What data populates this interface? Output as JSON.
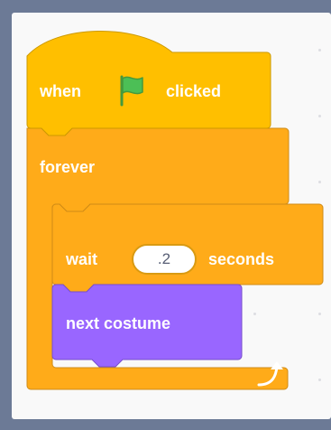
{
  "hat_block": {
    "when_label": "when",
    "flag_icon": "green-flag-icon",
    "clicked_label": "clicked",
    "color": "#ffbf00"
  },
  "forever_block": {
    "label": "forever",
    "loop_icon": "loop-arrow-icon",
    "color": "#ffab19"
  },
  "wait_block": {
    "wait_label": "wait",
    "duration_value": ".2",
    "seconds_label": "seconds",
    "color": "#ffab19"
  },
  "next_costume_block": {
    "label": "next costume",
    "color": "#9966ff"
  },
  "workspace": {
    "background": "#f9f9f9"
  }
}
